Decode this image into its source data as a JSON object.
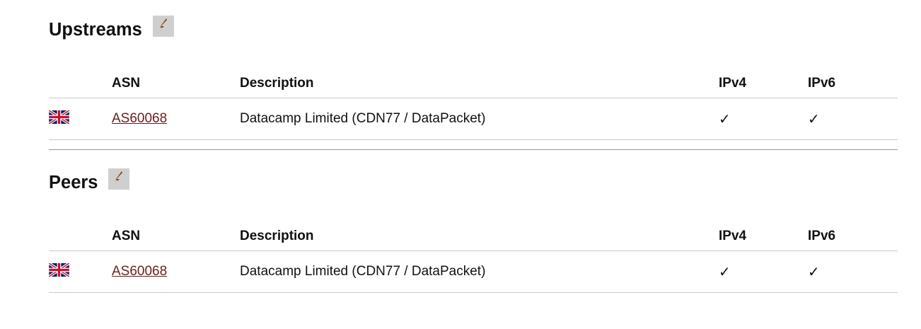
{
  "upstreams": {
    "title": "Upstreams",
    "bolt_icon": "lightning-bolt-icon",
    "columns": {
      "asn": "ASN",
      "description": "Description",
      "ipv4": "IPv4",
      "ipv6": "IPv6"
    },
    "rows": [
      {
        "flag_icon": "uk-flag-icon",
        "asn": "AS60068",
        "description": "Datacamp Limited (CDN77 / DataPacket)",
        "ipv4": "✓",
        "ipv6": "✓"
      }
    ]
  },
  "peers": {
    "title": "Peers",
    "bolt_icon": "lightning-bolt-icon",
    "columns": {
      "asn": "ASN",
      "description": "Description",
      "ipv4": "IPv4",
      "ipv6": "IPv6"
    },
    "rows": [
      {
        "flag_icon": "uk-flag-icon",
        "asn": "AS60068",
        "description": "Datacamp Limited (CDN77 / DataPacket)",
        "ipv4": "✓",
        "ipv6": "✓"
      }
    ]
  },
  "colors": {
    "link": "#6b1d1d",
    "bolt": "#8b4513",
    "bolt_bg": "#cfcfcf",
    "rule": "#c8c8c8"
  }
}
